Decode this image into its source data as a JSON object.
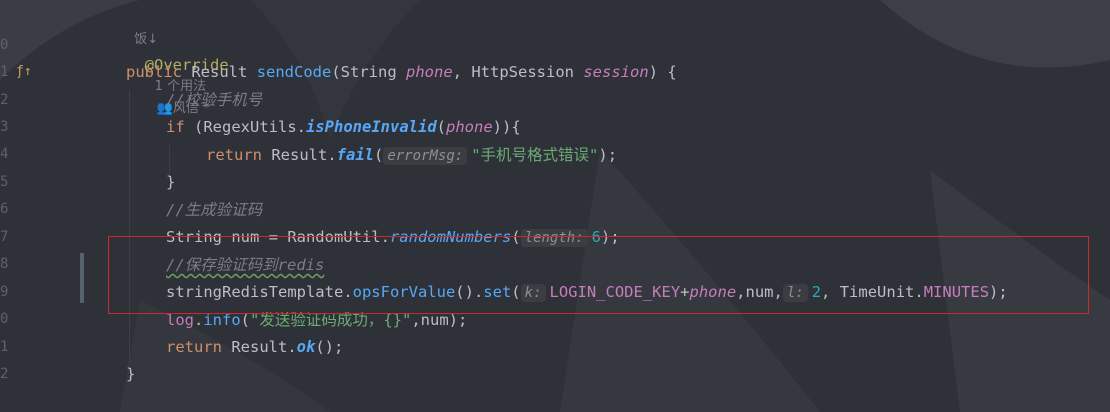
{
  "gutter": {
    "line_numbers": [
      "0",
      "1",
      "2",
      "3",
      "4",
      "5",
      "6",
      "7",
      "8",
      "9",
      "0",
      "1",
      "2"
    ]
  },
  "inlay": {
    "author_hint": "饭↓",
    "usages": "1 个用法",
    "author": "风信 *"
  },
  "code": {
    "annotation": "@Override",
    "sig_public": "public",
    "sig_result": "Result",
    "sig_method": "sendCode",
    "sig_string": "(String ",
    "sig_phone": "phone",
    "sig_comma": ", HttpSession ",
    "sig_session": "session",
    "sig_end": ") {",
    "c1": "//校验手机号",
    "if_kw": "if",
    "if_a": " (RegexUtils.",
    "if_fn": "isPhoneInvalid",
    "if_b": "(",
    "if_phone": "phone",
    "if_c": ")){",
    "ret_kw": "return",
    "ret_a": " Result.",
    "ret_fn": "fail",
    "ret_b": "(",
    "ret_hint": "errorMsg:",
    "ret_str": "\"手机号格式错误\"",
    "ret_c": ");",
    "close1": "}",
    "c2": "//生成验证码",
    "gen_a": "String num = RandomUtil.",
    "gen_fn": "randomNumbers",
    "gen_b": "(",
    "gen_hint": "length:",
    "gen_num": "6",
    "gen_c": ");",
    "c3": "//保存验证码到redis",
    "set_a": "stringRedisTemplate.",
    "set_fn1": "opsForValue",
    "set_b": "().",
    "set_fn2": "set",
    "set_c": "(",
    "set_hint_k": "k:",
    "set_const": "LOGIN_CODE_KEY",
    "set_plus": "+",
    "set_phone": "phone",
    "set_d": ",num,",
    "set_hint_l": "l:",
    "set_num": "2",
    "set_e": ", TimeUnit.",
    "set_const2": "MINUTES",
    "set_f": ");",
    "log_a": "log",
    "log_b": ".",
    "log_fn": "info",
    "log_c": "(",
    "log_str": "\"发送验证码成功，{}\"",
    "log_d": ",num);",
    "ok_kw": "return",
    "ok_a": " Result.",
    "ok_fn": "ok",
    "ok_b": "();",
    "close2": "}"
  }
}
